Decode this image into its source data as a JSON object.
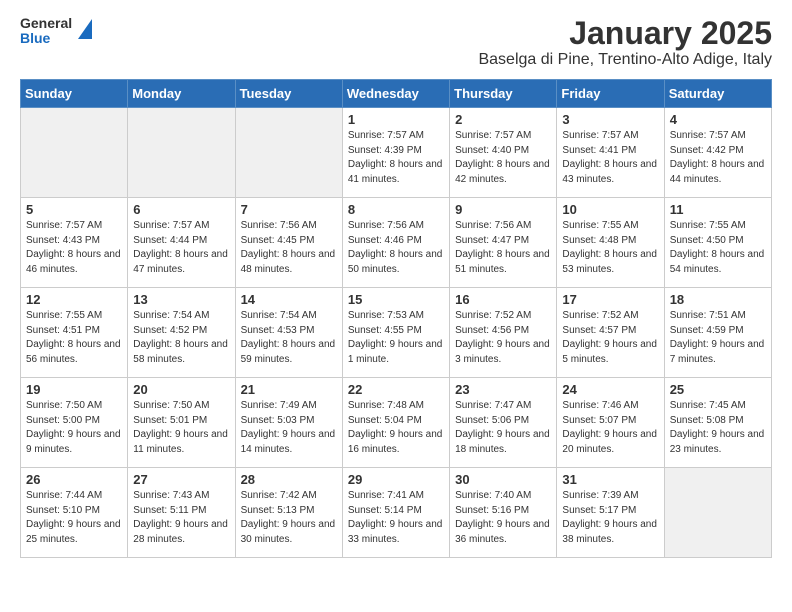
{
  "header": {
    "logo_general": "General",
    "logo_blue": "Blue",
    "title": "January 2025",
    "subtitle": "Baselga di Pine, Trentino-Alto Adige, Italy"
  },
  "days_of_week": [
    "Sunday",
    "Monday",
    "Tuesday",
    "Wednesday",
    "Thursday",
    "Friday",
    "Saturday"
  ],
  "weeks": [
    {
      "days": [
        {
          "num": "",
          "content": ""
        },
        {
          "num": "",
          "content": ""
        },
        {
          "num": "",
          "content": ""
        },
        {
          "num": "1",
          "content": "Sunrise: 7:57 AM\nSunset: 4:39 PM\nDaylight: 8 hours and 41 minutes."
        },
        {
          "num": "2",
          "content": "Sunrise: 7:57 AM\nSunset: 4:40 PM\nDaylight: 8 hours and 42 minutes."
        },
        {
          "num": "3",
          "content": "Sunrise: 7:57 AM\nSunset: 4:41 PM\nDaylight: 8 hours and 43 minutes."
        },
        {
          "num": "4",
          "content": "Sunrise: 7:57 AM\nSunset: 4:42 PM\nDaylight: 8 hours and 44 minutes."
        }
      ]
    },
    {
      "days": [
        {
          "num": "5",
          "content": "Sunrise: 7:57 AM\nSunset: 4:43 PM\nDaylight: 8 hours and 46 minutes."
        },
        {
          "num": "6",
          "content": "Sunrise: 7:57 AM\nSunset: 4:44 PM\nDaylight: 8 hours and 47 minutes."
        },
        {
          "num": "7",
          "content": "Sunrise: 7:56 AM\nSunset: 4:45 PM\nDaylight: 8 hours and 48 minutes."
        },
        {
          "num": "8",
          "content": "Sunrise: 7:56 AM\nSunset: 4:46 PM\nDaylight: 8 hours and 50 minutes."
        },
        {
          "num": "9",
          "content": "Sunrise: 7:56 AM\nSunset: 4:47 PM\nDaylight: 8 hours and 51 minutes."
        },
        {
          "num": "10",
          "content": "Sunrise: 7:55 AM\nSunset: 4:48 PM\nDaylight: 8 hours and 53 minutes."
        },
        {
          "num": "11",
          "content": "Sunrise: 7:55 AM\nSunset: 4:50 PM\nDaylight: 8 hours and 54 minutes."
        }
      ]
    },
    {
      "days": [
        {
          "num": "12",
          "content": "Sunrise: 7:55 AM\nSunset: 4:51 PM\nDaylight: 8 hours and 56 minutes."
        },
        {
          "num": "13",
          "content": "Sunrise: 7:54 AM\nSunset: 4:52 PM\nDaylight: 8 hours and 58 minutes."
        },
        {
          "num": "14",
          "content": "Sunrise: 7:54 AM\nSunset: 4:53 PM\nDaylight: 8 hours and 59 minutes."
        },
        {
          "num": "15",
          "content": "Sunrise: 7:53 AM\nSunset: 4:55 PM\nDaylight: 9 hours and 1 minute."
        },
        {
          "num": "16",
          "content": "Sunrise: 7:52 AM\nSunset: 4:56 PM\nDaylight: 9 hours and 3 minutes."
        },
        {
          "num": "17",
          "content": "Sunrise: 7:52 AM\nSunset: 4:57 PM\nDaylight: 9 hours and 5 minutes."
        },
        {
          "num": "18",
          "content": "Sunrise: 7:51 AM\nSunset: 4:59 PM\nDaylight: 9 hours and 7 minutes."
        }
      ]
    },
    {
      "days": [
        {
          "num": "19",
          "content": "Sunrise: 7:50 AM\nSunset: 5:00 PM\nDaylight: 9 hours and 9 minutes."
        },
        {
          "num": "20",
          "content": "Sunrise: 7:50 AM\nSunset: 5:01 PM\nDaylight: 9 hours and 11 minutes."
        },
        {
          "num": "21",
          "content": "Sunrise: 7:49 AM\nSunset: 5:03 PM\nDaylight: 9 hours and 14 minutes."
        },
        {
          "num": "22",
          "content": "Sunrise: 7:48 AM\nSunset: 5:04 PM\nDaylight: 9 hours and 16 minutes."
        },
        {
          "num": "23",
          "content": "Sunrise: 7:47 AM\nSunset: 5:06 PM\nDaylight: 9 hours and 18 minutes."
        },
        {
          "num": "24",
          "content": "Sunrise: 7:46 AM\nSunset: 5:07 PM\nDaylight: 9 hours and 20 minutes."
        },
        {
          "num": "25",
          "content": "Sunrise: 7:45 AM\nSunset: 5:08 PM\nDaylight: 9 hours and 23 minutes."
        }
      ]
    },
    {
      "days": [
        {
          "num": "26",
          "content": "Sunrise: 7:44 AM\nSunset: 5:10 PM\nDaylight: 9 hours and 25 minutes."
        },
        {
          "num": "27",
          "content": "Sunrise: 7:43 AM\nSunset: 5:11 PM\nDaylight: 9 hours and 28 minutes."
        },
        {
          "num": "28",
          "content": "Sunrise: 7:42 AM\nSunset: 5:13 PM\nDaylight: 9 hours and 30 minutes."
        },
        {
          "num": "29",
          "content": "Sunrise: 7:41 AM\nSunset: 5:14 PM\nDaylight: 9 hours and 33 minutes."
        },
        {
          "num": "30",
          "content": "Sunrise: 7:40 AM\nSunset: 5:16 PM\nDaylight: 9 hours and 36 minutes."
        },
        {
          "num": "31",
          "content": "Sunrise: 7:39 AM\nSunset: 5:17 PM\nDaylight: 9 hours and 38 minutes."
        },
        {
          "num": "",
          "content": ""
        }
      ]
    }
  ]
}
